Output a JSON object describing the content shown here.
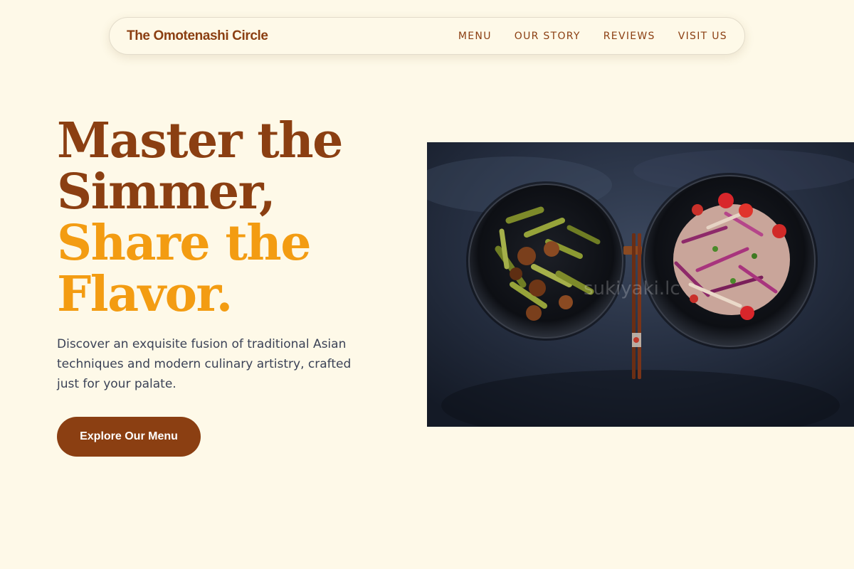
{
  "header": {
    "brand": "The Omotenashi Circle",
    "nav": [
      {
        "label": "MENU"
      },
      {
        "label": "OUR STORY"
      },
      {
        "label": "REVIEWS"
      },
      {
        "label": "VISIT US"
      }
    ]
  },
  "hero": {
    "title_line1": "Master the",
    "title_line2": "Simmer,",
    "title_line3": "Share the",
    "title_line4": "Flavor.",
    "description": "Discover an exquisite fusion of traditional Asian techniques and modern culinary artistry, crafted just for your palate.",
    "cta_label": "Explore Our Menu",
    "image_watermark": "sukiyaki.lc"
  },
  "colors": {
    "background": "#fef9e8",
    "primary_brown": "#8b3f12",
    "accent_amber": "#f39c12",
    "body_text": "#3b4256"
  }
}
